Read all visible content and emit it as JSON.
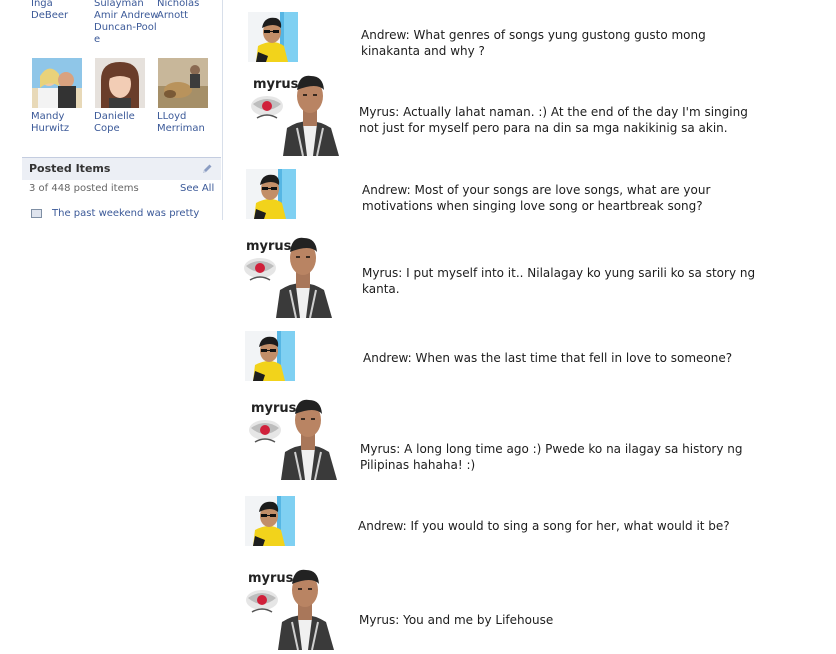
{
  "sidebar": {
    "friends": [
      {
        "name": "Inga DeBeer"
      },
      {
        "name": "Sulayman Amir Andrew Duncan-Poole"
      },
      {
        "name": "Nicholas Arnott"
      },
      {
        "name": "Mandy Hurwitz"
      },
      {
        "name": "Danielle Cope"
      },
      {
        "name": "LLoyd Merriman"
      }
    ],
    "name_lines": {
      "inga_1": "Inga",
      "inga_2": "DeBeer",
      "sulayman_1": "Sulayman",
      "sulayman_2": "Amir Andrew",
      "sulayman_3": "Duncan-Pool",
      "sulayman_4": "e",
      "nicholas_1": "Nicholas",
      "nicholas_2": "Arnott",
      "mandy_1": "Mandy",
      "mandy_2": "Hurwitz",
      "danielle_1": "Danielle",
      "danielle_2": "Cope",
      "lloyd_1": "LLoyd",
      "lloyd_2": "Merriman"
    },
    "posted_items": {
      "title": "Posted Items",
      "count_text": "3 of 448 posted items",
      "see_all": "See All",
      "first_item": "The past weekend was pretty"
    }
  },
  "interview": {
    "logo_text": "myrus",
    "rows": [
      {
        "speaker": "andrew",
        "text": "Andrew: What genres of songs yung gustong gusto mong kinakanta and why ?"
      },
      {
        "speaker": "myrus",
        "text": "Myrus: Actually lahat naman. :) At the end of the day I'm singing not just for myself pero para na din sa mga nakikinig sa akin."
      },
      {
        "speaker": "andrew",
        "text": "Andrew: Most of your songs are love songs, what are your motivations when singing love song or heartbreak song?"
      },
      {
        "speaker": "myrus",
        "text": "Myrus: I put myself into it.. Nilalagay ko yung sarili ko sa story ng kanta."
      },
      {
        "speaker": "andrew",
        "text": "Andrew: When was the last time that fell in love to someone?"
      },
      {
        "speaker": "myrus",
        "text": "Myrus: A long long time ago :) Pwede ko na ilagay sa history ng Pilipinas hahaha! :)"
      },
      {
        "speaker": "andrew",
        "text": "Andrew: If you would to sing a song for her, what would it be?"
      },
      {
        "speaker": "myrus",
        "text": "Myrus: You and me by Lifehouse"
      }
    ]
  },
  "colors": {
    "link": "#3b5998",
    "header_bg": "#eceff5",
    "text": "#1d1d1d"
  }
}
